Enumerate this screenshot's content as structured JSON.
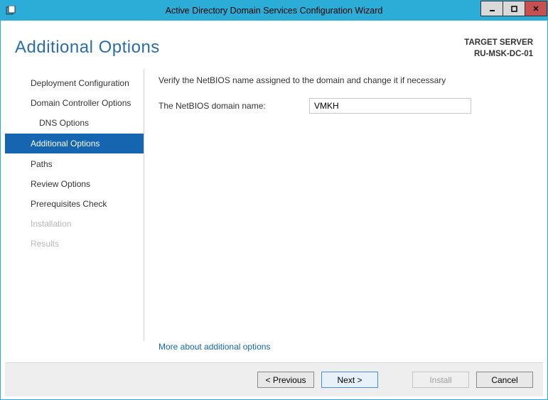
{
  "window": {
    "title": "Active Directory Domain Services Configuration Wizard"
  },
  "header": {
    "page_title": "Additional Options",
    "target_label": "TARGET SERVER",
    "target_server": "RU-MSK-DC-01"
  },
  "sidebar": {
    "items": [
      {
        "label": "Deployment Configuration",
        "state": "normal"
      },
      {
        "label": "Domain Controller Options",
        "state": "normal"
      },
      {
        "label": "DNS Options",
        "state": "sub"
      },
      {
        "label": "Additional Options",
        "state": "active"
      },
      {
        "label": "Paths",
        "state": "normal"
      },
      {
        "label": "Review Options",
        "state": "normal"
      },
      {
        "label": "Prerequisites Check",
        "state": "normal"
      },
      {
        "label": "Installation",
        "state": "disabled"
      },
      {
        "label": "Results",
        "state": "disabled"
      }
    ]
  },
  "main": {
    "instruction": "Verify the NetBIOS name assigned to the domain and change it if necessary",
    "netbios_label": "The NetBIOS domain name:",
    "netbios_value": "VMKH",
    "more_link": "More about additional options"
  },
  "footer": {
    "previous": "< Previous",
    "next": "Next >",
    "install": "Install",
    "cancel": "Cancel"
  }
}
